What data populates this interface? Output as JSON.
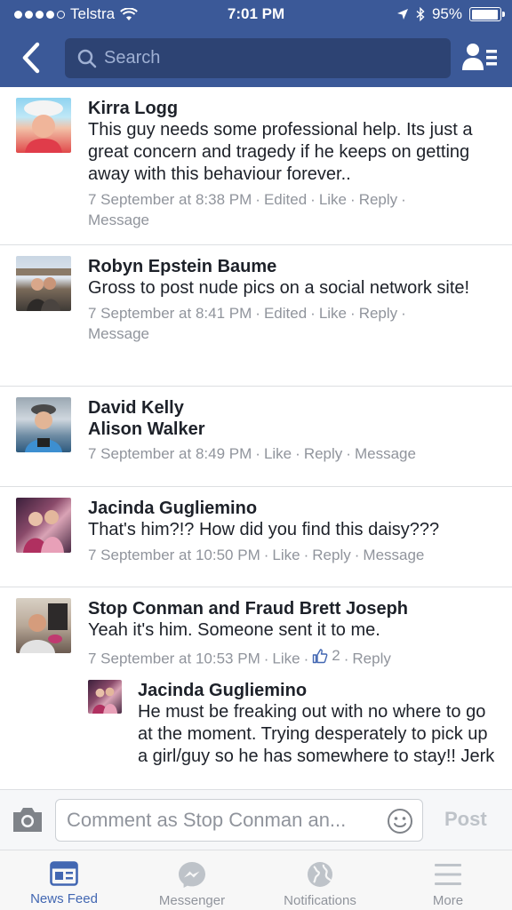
{
  "status_bar": {
    "carrier": "Telstra",
    "time": "7:01 PM",
    "battery": "95%",
    "battery_level": 0.95
  },
  "header": {
    "search_placeholder": "Search"
  },
  "comments": [
    {
      "name": "Kirra Logg",
      "text": "This guy needs some professional help.  Its just a great concern and tragedy if he keeps on getting away with this behaviour forever..",
      "time": "7 September at 8:38 PM",
      "edited": "Edited",
      "like": "Like",
      "reply": "Reply",
      "message": "Message"
    },
    {
      "name": "Robyn Epstein Baume",
      "text": "Gross to post nude pics on a social network site!",
      "time": "7 September at 8:41 PM",
      "edited": "Edited",
      "like": "Like",
      "reply": "Reply",
      "message": "Message"
    },
    {
      "name": "David Kelly",
      "text": "Alison Walker",
      "time": "7 September at 8:49 PM",
      "like": "Like",
      "reply": "Reply",
      "message": "Message"
    },
    {
      "name": "Jacinda Gugliemino",
      "text": "That's him?!? How did you find this daisy???",
      "time": "7 September at 10:50 PM",
      "like": "Like",
      "reply": "Reply",
      "message": "Message"
    },
    {
      "name": "Stop Conman and Fraud Brett Joseph",
      "text": "Yeah it's him. Someone sent it to me.",
      "time": "7 September at 10:53 PM",
      "like": "Like",
      "like_count": "2",
      "reply": "Reply",
      "replies": [
        {
          "name": "Jacinda Gugliemino",
          "text": "He must be freaking out with no where to go at the moment. Trying desperately to pick up a girl/guy so he has somewhere to stay!! Jerk"
        }
      ]
    }
  ],
  "composer": {
    "placeholder": "Comment as Stop Conman an...",
    "post_label": "Post"
  },
  "tabs": [
    {
      "label": "News Feed",
      "icon": "news-feed-icon",
      "active": true
    },
    {
      "label": "Messenger",
      "icon": "messenger-icon",
      "active": false
    },
    {
      "label": "Notifications",
      "icon": "globe-icon",
      "active": false
    },
    {
      "label": "More",
      "icon": "menu-icon",
      "active": false
    }
  ],
  "colors": {
    "brand": "#3b5998",
    "active_tab": "#4267b2",
    "meta_text": "#90949c"
  }
}
